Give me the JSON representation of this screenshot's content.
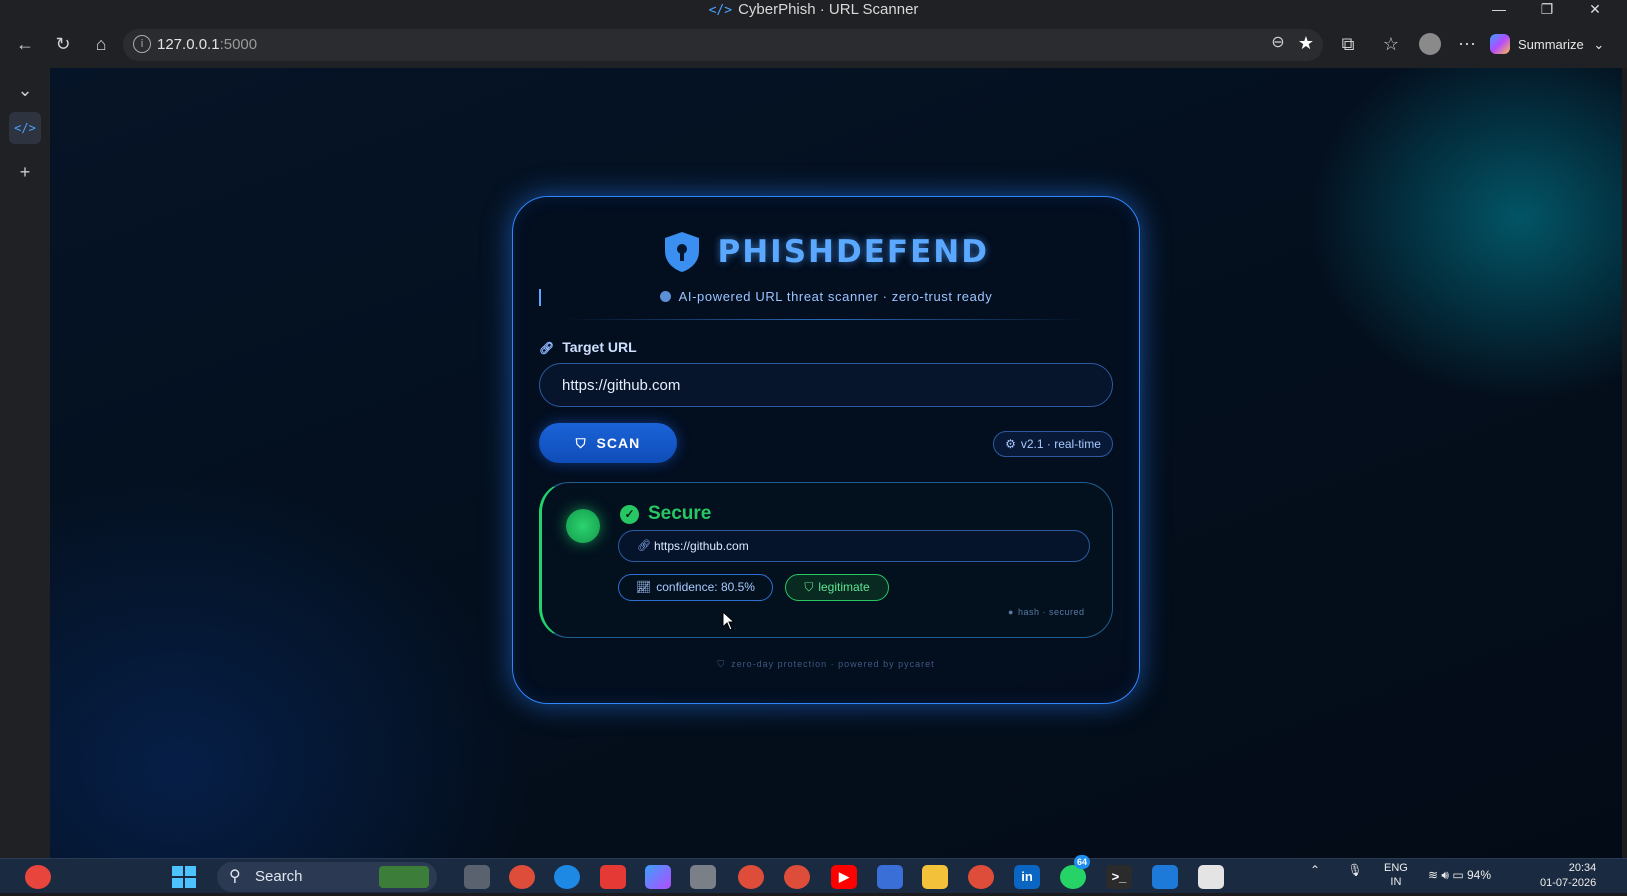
{
  "window": {
    "title": "CyberPhish · URL Scanner",
    "title_icon": "code-icon"
  },
  "browser": {
    "url_host": "127.0.0.1",
    "url_port": ":5000",
    "summarize_label": "Summarize"
  },
  "app": {
    "brand": "PHISHDEFEND",
    "tagline": "AI-powered URL threat scanner · zero-trust ready",
    "target_label": "Target URL",
    "url_value": "https://github.com",
    "scan_label": "SCAN",
    "version_badge": "v2.1 · real-time",
    "result": {
      "status": "Secure",
      "url": "https://github.com",
      "confidence": "confidence: 80.5%",
      "verdict": "legitimate",
      "hash_note": "hash · secured"
    },
    "footer": "zero-day protection · powered by pycaret",
    "colors": {
      "accent": "#2f86ff",
      "secure": "#27c864"
    }
  },
  "taskbar": {
    "search_label": "Search",
    "whatsapp_badge": "64",
    "battery": "94%",
    "lang_top": "ENG",
    "lang_bottom": "IN",
    "time": "20:34",
    "date": "01-07-2026"
  }
}
